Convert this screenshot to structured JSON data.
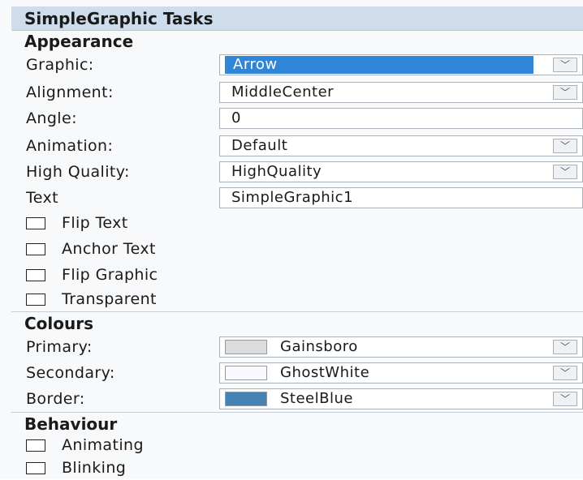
{
  "title": "SimpleGraphic Tasks",
  "appearance": {
    "heading": "Appearance",
    "graphic": {
      "label": "Graphic:",
      "value": "Arrow",
      "dropdown_icon": "chevron-down"
    },
    "alignment": {
      "label": "Alignment:",
      "value": "MiddleCenter",
      "dropdown_icon": "chevron-down"
    },
    "angle": {
      "label": "Angle:",
      "value": "0"
    },
    "animation": {
      "label": "Animation:",
      "value": "Default",
      "dropdown_icon": "chevron-down"
    },
    "high_quality": {
      "label": "High Quality:",
      "value": "HighQuality",
      "dropdown_icon": "chevron-down"
    },
    "text": {
      "label": "Text",
      "value": "SimpleGraphic1"
    },
    "flip_text": {
      "label": "Flip Text",
      "checked": false
    },
    "anchor_text": {
      "label": "Anchor Text",
      "checked": false
    },
    "flip_graphic": {
      "label": "Flip Graphic",
      "checked": false
    },
    "transparent": {
      "label": "Transparent",
      "checked": false
    }
  },
  "colours": {
    "heading": "Colours",
    "primary": {
      "label": "Primary:",
      "value": "Gainsboro",
      "swatch": "#dcdcdc",
      "dropdown_icon": "chevron-down"
    },
    "secondary": {
      "label": "Secondary:",
      "value": "GhostWhite",
      "swatch": "#f8f8ff",
      "dropdown_icon": "chevron-down"
    },
    "border": {
      "label": "Border:",
      "value": "SteelBlue",
      "swatch": "#4682b4",
      "dropdown_icon": "chevron-down"
    }
  },
  "behaviour": {
    "heading": "Behaviour",
    "animating": {
      "label": "Animating",
      "checked": false
    },
    "blinking": {
      "label": "Blinking",
      "checked": false
    }
  },
  "colors": {
    "title_bar": "#cfdcec",
    "selection": "#2f86d8"
  }
}
